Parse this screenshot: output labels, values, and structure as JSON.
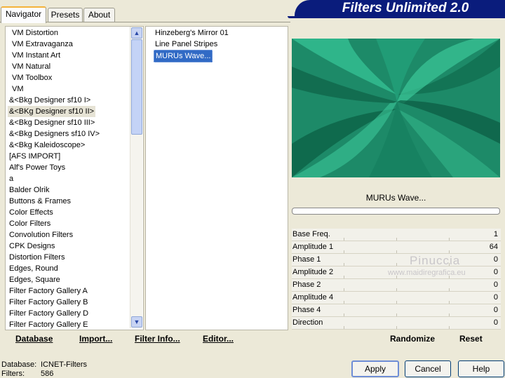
{
  "tabs": [
    "Navigator",
    "Presets",
    "About"
  ],
  "banner_title": "Filters Unlimited 2.0",
  "categories": [
    "VM Distortion",
    "VM Extravaganza",
    "VM Instant Art",
    "VM Natural",
    "VM Toolbox",
    "VM",
    "&<Bkg Designer sf10 I>",
    "&<BKg Designer sf10 II>",
    "&<Bkg Designer sf10 III>",
    "&<Bkg Designers sf10 IV>",
    "&<Bkg Kaleidoscope>",
    "[AFS IMPORT]",
    "Alf's Power Toys",
    "a",
    "Balder Olrik",
    "Buttons & Frames",
    "Color Effects",
    "Color Filters",
    "Convolution Filters",
    "CPK Designs",
    "Distortion Filters",
    "Edges, Round",
    "Edges, Square",
    "Filter Factory Gallery A",
    "Filter Factory Gallery B",
    "Filter Factory Gallery D",
    "Filter Factory Gallery E"
  ],
  "selected_category": "&<BKg Designer sf10 II>",
  "filters": [
    "Hinzeberg's Mirror 01",
    "Line Panel Stripes",
    "MURUs Wave..."
  ],
  "selected_filter": "MURUs Wave...",
  "links": {
    "database": "Database",
    "import": "Import...",
    "filter_info": "Filter Info...",
    "editor": "Editor..."
  },
  "preview": {
    "name": "MURUs Wave...",
    "color": "#1f8f6d"
  },
  "params": [
    {
      "name": "Base Freq.",
      "value": "1"
    },
    {
      "name": "Amplitude 1",
      "value": "64"
    },
    {
      "name": "Phase 1",
      "value": "0"
    },
    {
      "name": "Amplitude 2",
      "value": "0"
    },
    {
      "name": "Phase 2",
      "value": "0"
    },
    {
      "name": "Amplitude 4",
      "value": "0"
    },
    {
      "name": "Phase 4",
      "value": "0"
    },
    {
      "name": "Direction",
      "value": "0"
    }
  ],
  "randomize": "Randomize",
  "reset": "Reset",
  "watermark": {
    "line1": "Pinuccia",
    "line2": "www.maidiregrafica.eu"
  },
  "status": {
    "db_label": "Database:",
    "db_value": "ICNET-Filters",
    "f_label": "Filters:",
    "f_value": "586"
  },
  "buttons": {
    "apply": "Apply",
    "cancel": "Cancel",
    "help": "Help"
  }
}
